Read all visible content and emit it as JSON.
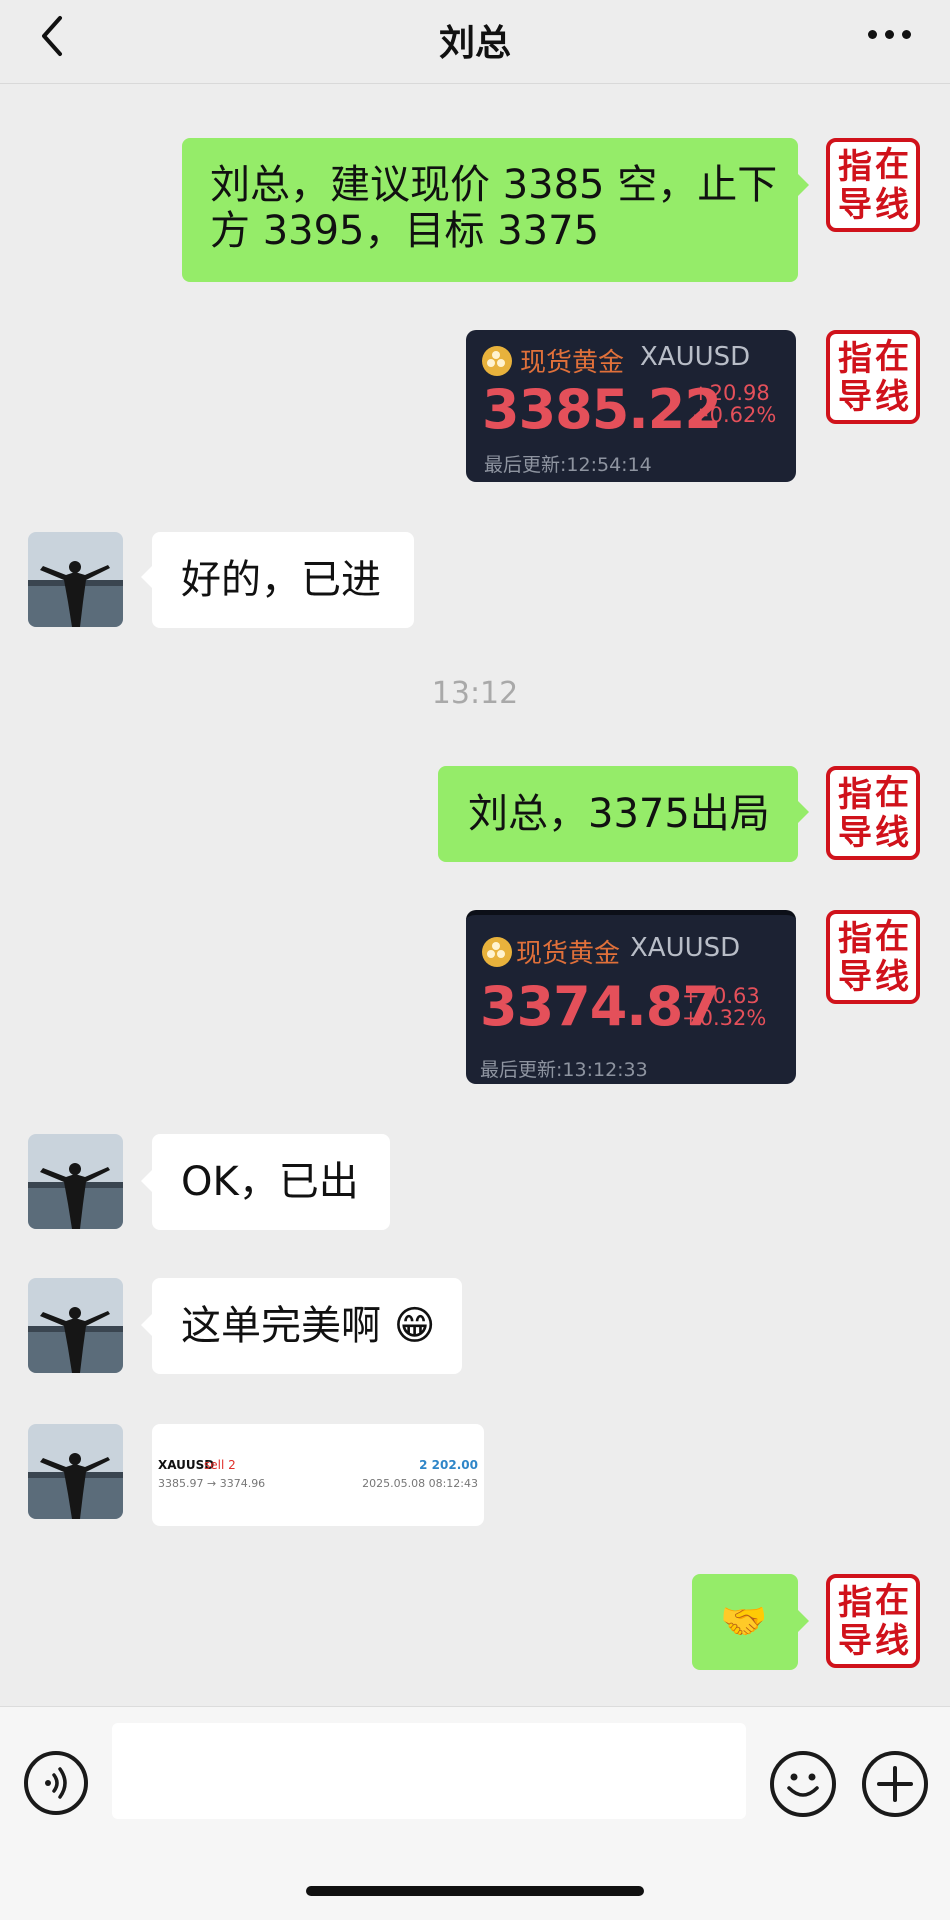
{
  "header": {
    "title": "刘总",
    "back_icon": "chevron-left-icon",
    "more_icon": "ellipsis-icon"
  },
  "stamp": {
    "chars": [
      "指",
      "在",
      "导",
      "线"
    ],
    "color": "#d0121b"
  },
  "messages": [
    {
      "line1": "刘总，建议现价 3385 空，止下",
      "line2": "方 3395，目标 3375"
    },
    {
      "quote": {
        "label": "现货黄金",
        "symbol": "XAUUSD",
        "price": "3385.22",
        "change": "+20.98",
        "change_pct": "+0.62%",
        "updated": "最后更新:12:54:14"
      }
    },
    {
      "text": "好的，已进"
    },
    {
      "text": "刘总，3375出局"
    },
    {
      "quote": {
        "label": "现货黄金",
        "symbol": "XAUUSD",
        "price": "3374.87",
        "change": "+10.63",
        "change_pct": "+0.32%",
        "updated": "最后更新:13:12:33"
      }
    },
    {
      "text": "OK，已出"
    },
    {
      "text": "这单完美啊",
      "emoji": "😁"
    },
    {
      "trade": {
        "symbol": "XAUUSD",
        "side": "sell 2",
        "profit": "2 202.00",
        "prices": "3385.97 → 3374.96",
        "datetime": "2025.05.08 08:12:43"
      }
    },
    {
      "emoji": "🤝"
    }
  ],
  "timestamp": "13:12",
  "input_bar": {
    "voice_icon": "voice-icon",
    "emoji_icon": "smiley-icon",
    "plus_icon": "plus-icon",
    "placeholder": ""
  },
  "colors": {
    "accent_green": "#95ec69",
    "background": "#ededed",
    "quote_bg": "#1c2233",
    "price_red": "#e4505a"
  }
}
